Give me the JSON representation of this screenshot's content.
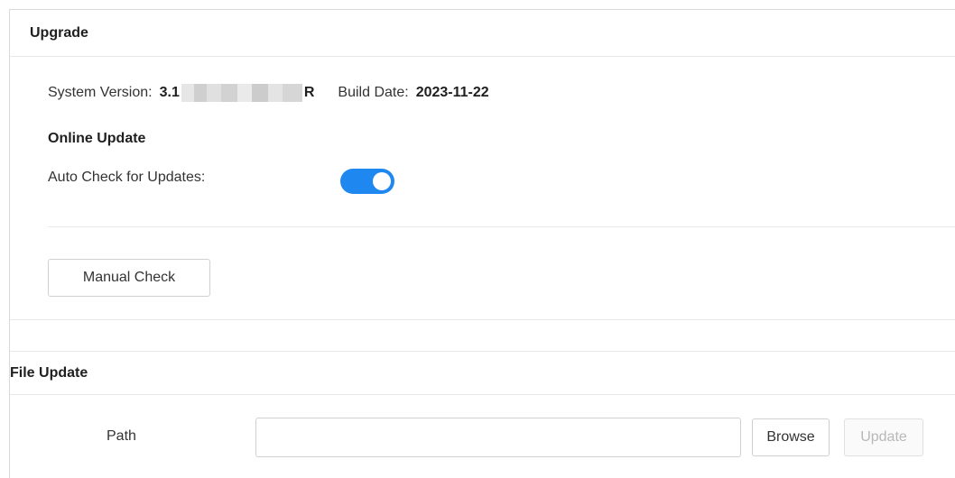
{
  "upgrade": {
    "title": "Upgrade",
    "system_version_label": "System Version:",
    "system_version_prefix": "3.1",
    "system_version_suffix": "R",
    "build_date_label": "Build Date:",
    "build_date_value": "2023-11-22"
  },
  "online_update": {
    "heading": "Online Update",
    "auto_check_label": "Auto Check for Updates:",
    "auto_check_enabled": true,
    "toggle_color": "#1e88f0",
    "manual_check_label": "Manual Check"
  },
  "file_update": {
    "title": "File Update",
    "path_label": "Path",
    "path_value": "",
    "browse_label": "Browse",
    "update_label": "Update",
    "update_enabled": false
  }
}
